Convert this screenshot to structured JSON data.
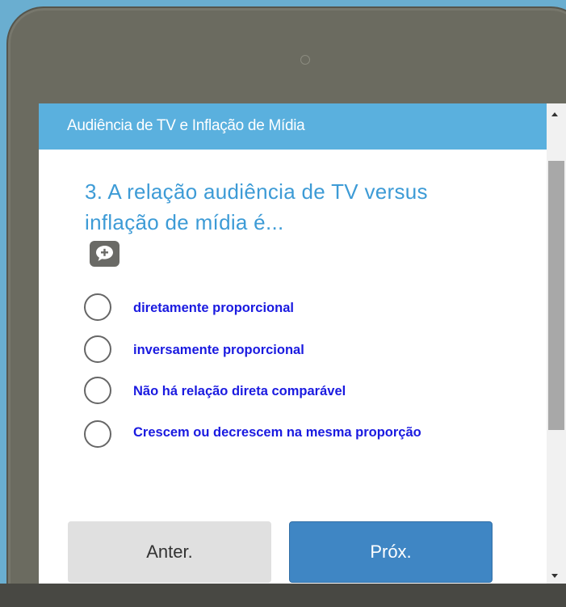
{
  "survey": {
    "title": "Audiência de TV e Inflação de Mídia",
    "question": "3. A relação audiência de TV versus inflação de mídia é...",
    "options": [
      {
        "label": "diretamente proporcional",
        "selected": false
      },
      {
        "label": "inversamente proporcional",
        "selected": false
      },
      {
        "label": "Não há relação direta comparável",
        "selected": false
      },
      {
        "label": "Crescem ou decrescem na mesma proporção",
        "selected": false
      }
    ]
  },
  "nav": {
    "prev_label": "Anter.",
    "next_label": "Próx."
  },
  "icons": {
    "comment": "comment-add-icon",
    "scroll_up": "chevron-up-icon",
    "scroll_down": "chevron-down-icon"
  },
  "colors": {
    "header": "#5ab0de",
    "question": "#3d9bd6",
    "option_text": "#1a1ae0",
    "next_button": "#3f86c4",
    "prev_button": "#e0e0e0"
  }
}
